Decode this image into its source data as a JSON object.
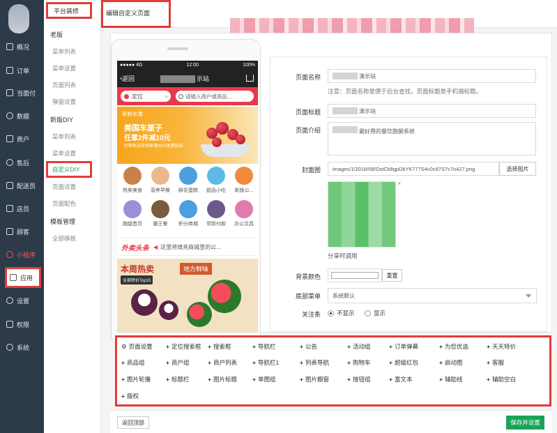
{
  "nav1": {
    "items": [
      {
        "label": "概况",
        "icon": "overview-icon"
      },
      {
        "label": "订单",
        "icon": "order-icon"
      },
      {
        "label": "当面付",
        "icon": "pay-icon"
      },
      {
        "label": "数据",
        "icon": "data-icon"
      },
      {
        "label": "商户",
        "icon": "merchant-icon"
      },
      {
        "label": "售后",
        "icon": "aftersale-icon"
      },
      {
        "label": "配送员",
        "icon": "courier-icon"
      },
      {
        "label": "店员",
        "icon": "clerk-icon"
      },
      {
        "label": "顾客",
        "icon": "customer-icon"
      },
      {
        "label": "小程序",
        "icon": "miniprogram-icon"
      },
      {
        "label": "应用",
        "icon": "app-icon"
      },
      {
        "label": "设置",
        "icon": "gear-icon"
      },
      {
        "label": "权限",
        "icon": "lock-icon"
      },
      {
        "label": "系统",
        "icon": "system-icon"
      }
    ]
  },
  "nav2": {
    "head": "平台装修",
    "group_old": "老版",
    "old_items": [
      "菜单列表",
      "菜单设置",
      "页面列表",
      "弹窗设置"
    ],
    "group_new": "新版DIY",
    "new_items": [
      "菜单列表",
      "菜单设置",
      "自定义DIY",
      "页面设置",
      "页面配色"
    ],
    "group_tpl": "模板管理",
    "tpl_items": [
      "全部模板"
    ]
  },
  "tab": {
    "title": "编辑自定义页面"
  },
  "phone": {
    "status_left": "●●●●● 4G",
    "status_mid": "12:00",
    "status_right": "100%",
    "back_label": "返回",
    "title_suffix": "示站",
    "location_label": "定位",
    "search_placeholder": "请输入商户或商品...",
    "banner1": {
      "tag": "新鲜水果",
      "line1": "美国车厘子",
      "line2": "任意2件减10元",
      "line3": "好新鲜送货到家满39元免费配送"
    },
    "categories": [
      {
        "label": "热卖美食",
        "color": "#c9814a"
      },
      {
        "label": "营养早餐",
        "color": "#e9b98a"
      },
      {
        "label": "鲜花蛋糕",
        "color": "#4a9fe0"
      },
      {
        "label": "甜品小吃",
        "color": "#5cbbe6"
      },
      {
        "label": "新版公...",
        "color": "#f08a3c"
      },
      {
        "label": "跑腿首页",
        "color": "#9b8fd8"
      },
      {
        "label": "霸王餐",
        "color": "#7a5a3a"
      },
      {
        "label": "积分商城",
        "color": "#4aa0e0"
      },
      {
        "label": "领到付款",
        "color": "#6a5a8a"
      },
      {
        "label": "办公文具",
        "color": "#e07ab0"
      }
    ],
    "news_brand": "外卖头条",
    "news_text": "这里将填充商城里的公...",
    "banner2": {
      "t1": "本周热卖",
      "t2": "全部特价Top15",
      "t3": "地方鲜味"
    }
  },
  "form": {
    "name_label": "页面名称",
    "name_value": "演示站",
    "name_note": "注意：页面名称是便于后台查找，页面标题是手机端标题。",
    "title_label": "页面标题",
    "title_value": "演示站",
    "desc_label": "页面介绍",
    "desc_value": "最好用的餐饮跑腿系统",
    "cover_label": "封面图",
    "cover_path": "images/1/2018/08/OstCk8gpDkYK777S4c0c87S7c7o427.png",
    "choose_image": "选择图片",
    "close_symbol": "×",
    "share_caption": "分享时调用",
    "bg_label": "背景颜色",
    "reset_label": "重置",
    "bg_color": "#ffffff",
    "menu_label": "底部菜单",
    "menu_value": "系统默认",
    "follow_label": "关注条",
    "opt_hide": "不显示",
    "opt_show": "显示"
  },
  "palette": {
    "items": [
      "页面设置",
      "定位搜索框",
      "搜索框",
      "导航栏",
      "公告",
      "活动组",
      "订单弹幕",
      "为您优选",
      "天天特价",
      "商品组",
      "商户组",
      "商户列表",
      "导航栏1",
      "列表导航",
      "购物车",
      "超级红包",
      "启动图",
      "客服",
      "图片轮播",
      "标题栏",
      "图片标题",
      "单图组",
      "图片橱窗",
      "按钮组",
      "富文本",
      "辅助线",
      "辅助空白",
      "版权"
    ]
  },
  "bottom": {
    "back_top": "返回顶部",
    "save": "保存并设置"
  }
}
